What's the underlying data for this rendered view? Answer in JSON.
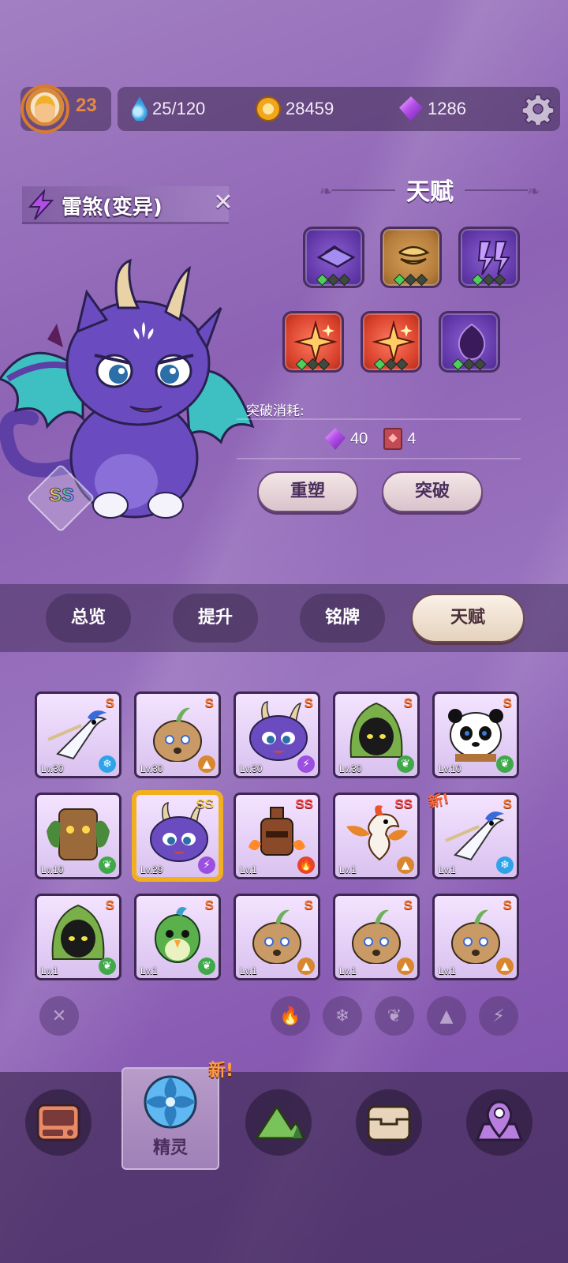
{
  "player": {
    "level": "23"
  },
  "resources": {
    "water": "25/120",
    "gold": "28459",
    "gems": "1286"
  },
  "pet": {
    "name": "雷煞(变异)",
    "rarity": "SS"
  },
  "talent": {
    "title": "天赋",
    "slots": [
      {
        "kind": "purple",
        "icon": "crystal-slab-icon",
        "level": 1
      },
      {
        "kind": "gold",
        "icon": "nest-icon",
        "level": 1
      },
      {
        "kind": "purple",
        "icon": "double-bolt-icon",
        "level": 1
      },
      {
        "kind": "red",
        "icon": "sparkle-icon",
        "level": 1
      },
      {
        "kind": "red",
        "icon": "sparkle-icon",
        "level": 1
      },
      {
        "kind": "purple",
        "icon": "soul-drop-icon",
        "level": 1
      }
    ],
    "cost_label": "突破消耗:",
    "cost_gems": "40",
    "cost_books": "4",
    "reforge_label": "重塑",
    "breakthrough_label": "突破"
  },
  "tabs": [
    "总览",
    "提升",
    "铭牌",
    "天赋"
  ],
  "active_tab": "天赋",
  "pets": [
    {
      "lv": "Lv.30",
      "rank": "S",
      "element": "ice",
      "art": "crane"
    },
    {
      "lv": "Lv.30",
      "rank": "S",
      "element": "earth",
      "art": "potato"
    },
    {
      "lv": "Lv.30",
      "rank": "S",
      "element": "thunder",
      "art": "dragon"
    },
    {
      "lv": "Lv.30",
      "rank": "S",
      "element": "grass",
      "art": "hood"
    },
    {
      "lv": "Lv.10",
      "rank": "S",
      "element": "grass",
      "art": "panda"
    },
    {
      "lv": "Lv.10",
      "rank": "",
      "element": "grass",
      "art": "stump"
    },
    {
      "lv": "Lv.29",
      "rank": "SS",
      "element": "thunder",
      "art": "dragon"
    },
    {
      "lv": "Lv.1",
      "rank": "SS",
      "element": "fire",
      "art": "golem"
    },
    {
      "lv": "Lv.1",
      "rank": "SS",
      "element": "earth",
      "art": "phoenix"
    },
    {
      "lv": "Lv.1",
      "rank": "S",
      "element": "ice",
      "art": "crane"
    },
    {
      "lv": "Lv.1",
      "rank": "S",
      "element": "grass",
      "art": "hood"
    },
    {
      "lv": "Lv.1",
      "rank": "S",
      "element": "grass",
      "art": "parrot"
    },
    {
      "lv": "Lv.1",
      "rank": "S",
      "element": "earth",
      "art": "potato"
    },
    {
      "lv": "Lv.1",
      "rank": "S",
      "element": "earth",
      "art": "potato"
    },
    {
      "lv": "Lv.1",
      "rank": "S",
      "element": "earth",
      "art": "potato"
    }
  ],
  "new_mark_grid": "新!",
  "filters": [
    "clear-filter-icon",
    "fire-filter-icon",
    "ice-filter-icon",
    "grass-filter-icon",
    "earth-filter-icon",
    "thunder-filter-icon"
  ],
  "nav": {
    "active_label": "精灵",
    "new_mark": "新!"
  }
}
